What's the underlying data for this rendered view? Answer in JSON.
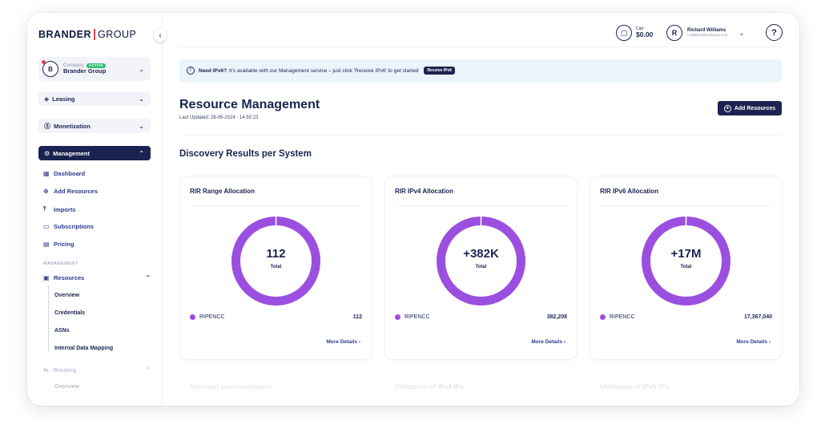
{
  "logo": {
    "part1": "BRANDER",
    "part2": "GROUP"
  },
  "sidebar": {
    "collapse_icon": "‹",
    "company": {
      "label": "Company",
      "badge": "ACTIVE",
      "name": "Brander Group",
      "avatar": "B"
    },
    "menus": [
      {
        "label": "Leasing",
        "icon": "tag-icon"
      },
      {
        "label": "Monetization",
        "icon": "dollar-icon"
      },
      {
        "label": "Management",
        "icon": "gear-icon"
      }
    ],
    "management_items": [
      {
        "label": "Dashboard",
        "icon": "grid-icon"
      },
      {
        "label": "Add Resources",
        "icon": "plus-circle-icon"
      },
      {
        "label": "Imports",
        "icon": "upload-icon"
      },
      {
        "label": "Subscriptions",
        "icon": "card-icon"
      },
      {
        "label": "Pricing",
        "icon": "document-icon"
      }
    ],
    "section_label": "MANAGEMENT",
    "resources": {
      "label": "Resources",
      "children": [
        "Overview",
        "Credentials",
        "ASNs",
        "Internal Data Mapping"
      ]
    },
    "routing": {
      "label": "Routing",
      "children": [
        "Overview"
      ]
    }
  },
  "topbar": {
    "cart": {
      "label": "Cart",
      "amount": "$0.00"
    },
    "user": {
      "avatar": "R",
      "name": "Richard Williams",
      "email": "r.williams@company.com"
    },
    "help": "?"
  },
  "banner": {
    "bold": "Need IPv6?",
    "text": "It's available with our Management service – just click 'Receive IPv6' to get started",
    "button": "Receive IPv6"
  },
  "header": {
    "title": "Resource Management",
    "updated": "Last Updated: 28-05-2024 · 14:50:23",
    "add_button": "Add Resources"
  },
  "section_title": "Discovery Results per System",
  "cards": [
    {
      "title": "RIR Range Allocation",
      "center": "112",
      "center_label": "Total",
      "legend": "RIPENCC",
      "value": "112",
      "more": "More Details ›"
    },
    {
      "title": "RIR IPv4 Allocation",
      "center": "+382K",
      "center_label": "Total",
      "legend": "RIPENCC",
      "value": "382,208",
      "more": "More Details ›"
    },
    {
      "title": "RIR IPv6 Allocation",
      "center": "+17M",
      "center_label": "Total",
      "legend": "RIPENCC",
      "value": "17,367,040",
      "more": "More Details ›"
    }
  ],
  "ghost_titles": [
    "Detected announcements",
    "Utilization of IPv4 IPs",
    "Utilization of IPv6 IPs"
  ],
  "colors": {
    "navy": "#1b2450",
    "purple": "#9b4fe0",
    "banner_bg": "#eaf4fb",
    "active_green": "#2fba6e"
  }
}
